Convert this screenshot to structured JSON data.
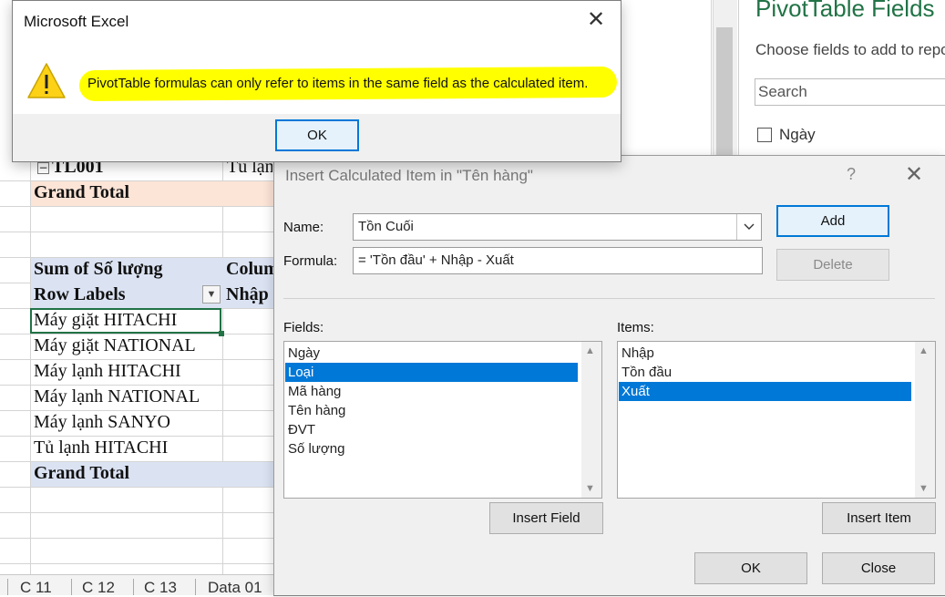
{
  "error_dialog": {
    "title": "Microsoft Excel",
    "message": "PivotTable formulas can only refer to items in the same field as the calculated item.",
    "ok_label": "OK",
    "close_glyph": "✕",
    "icon": "warning-icon"
  },
  "calc_dialog": {
    "title": "Insert Calculated Item in \"Tên hàng\"",
    "help_glyph": "?",
    "close_glyph": "✕",
    "name_label": "Name:",
    "name_value": "Tồn Cuối",
    "formula_label": "Formula:",
    "formula_value": "= 'Tồn đầu' + Nhập - Xuất",
    "add_label": "Add",
    "delete_label": "Delete",
    "fields_label": "Fields:",
    "fields": [
      "Ngày",
      "Loại",
      "Mã hàng",
      "Tên hàng",
      "ĐVT",
      "Số lượng"
    ],
    "selected_field": "Loại",
    "items_label": "Items:",
    "items": [
      "Nhập",
      "Tồn đầu",
      "Xuất"
    ],
    "selected_item": "Xuất",
    "insert_field_label": "Insert Field",
    "insert_item_label": "Insert Item",
    "ok_label": "OK",
    "close_label": "Close"
  },
  "pivot_pane": {
    "title": "PivotTable Fields",
    "subtitle": "Choose fields to add to report:",
    "search_placeholder": "Search",
    "field_visible": "Ngày"
  },
  "sheet": {
    "upper": {
      "row_label": "TL001",
      "row_value": "Tủ lạnh",
      "grand_total": "Grand Total"
    },
    "pivot": {
      "header_value": "Sum of Số lượng",
      "header_col": "Column",
      "row_labels": "Row Labels",
      "col_item": "Nhập",
      "rows": [
        "Máy giặt HITACHI",
        "Máy giặt NATIONAL",
        "Máy lạnh HITACHI",
        "Máy lạnh NATIONAL",
        "Máy lạnh SANYO",
        "Tủ lạnh HITACHI"
      ],
      "grand_total": "Grand Total"
    },
    "tabs": [
      "C 11",
      "C 12",
      "C 13",
      "Data 01"
    ]
  },
  "colors": {
    "excel_green": "#217346",
    "highlight": "#ffff00",
    "selection": "#0078d7",
    "pivot_header_band": "#dbe3f3",
    "grand_total_band_upper": "#fce4d6"
  }
}
